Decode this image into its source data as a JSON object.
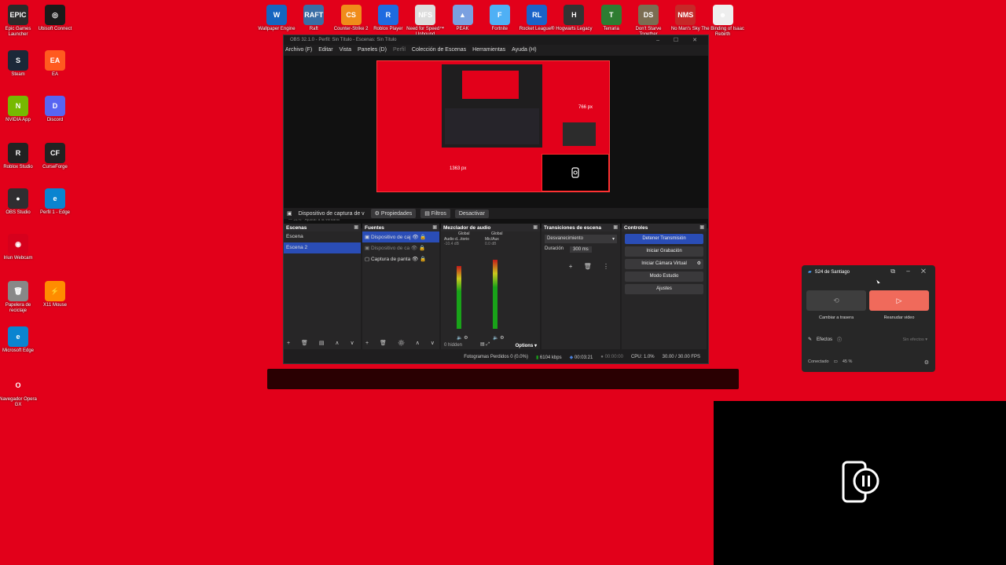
{
  "desktop": {
    "left_icons": [
      {
        "label": "Epic Games Launcher",
        "abbr": "EPIC",
        "color": "#2a2a2a"
      },
      {
        "label": "Ubisoft Connect",
        "abbr": "◎",
        "color": "#1a1a1a"
      },
      {
        "label": "Steam",
        "abbr": "S",
        "color": "#1b2838"
      },
      {
        "label": "EA",
        "abbr": "EA",
        "color": "#ff5a1f"
      },
      {
        "label": "NVIDIA App",
        "abbr": "N",
        "color": "#76b900"
      },
      {
        "label": "Discord",
        "abbr": "D",
        "color": "#5865f2"
      },
      {
        "label": "Roblox Studio",
        "abbr": "R",
        "color": "#222"
      },
      {
        "label": "CurseForge",
        "abbr": "CF",
        "color": "#222"
      },
      {
        "label": "OBS Studio",
        "abbr": "●",
        "color": "#302e31"
      },
      {
        "label": "Perfil 1 - Edge",
        "abbr": "e",
        "color": "#0a84d0"
      },
      {
        "label": "Iriun Webcam",
        "abbr": "◉",
        "color": "#d6001c"
      },
      {
        "label": "Papelera de reciclaje",
        "abbr": "🗑",
        "color": "#888"
      },
      {
        "label": "X11 Mouse",
        "abbr": "⚡",
        "color": "#ff8c00"
      },
      {
        "label": "Microsoft Edge",
        "abbr": "e",
        "color": "#0a84d0"
      },
      {
        "label": "Navegador Opera GX",
        "abbr": "O",
        "color": "#e2001a"
      }
    ],
    "top_icons": [
      {
        "label": "Wallpaper Engine",
        "abbr": "W",
        "color": "#1565c0"
      },
      {
        "label": "Raft",
        "abbr": "RAFT",
        "color": "#3a6ea5"
      },
      {
        "label": "Counter-Strike 2",
        "abbr": "CS",
        "color": "#f08c1a"
      },
      {
        "label": "Roblox Player",
        "abbr": "R",
        "color": "#1e6be0"
      },
      {
        "label": "Need for Speed™ Unbound",
        "abbr": "NFS",
        "color": "#ddd"
      },
      {
        "label": "PEAK",
        "abbr": "▲",
        "color": "#7aa0e0"
      },
      {
        "label": "Fortnite",
        "abbr": "F",
        "color": "#4fb0f5"
      },
      {
        "label": "Rocket League®",
        "abbr": "RL",
        "color": "#1a63c9"
      },
      {
        "label": "Hogwarts Legacy",
        "abbr": "H",
        "color": "#333"
      },
      {
        "label": "Terraria",
        "abbr": "T",
        "color": "#2e7d32"
      },
      {
        "label": "Don't Starve Together",
        "abbr": "DS",
        "color": "#7b6d52"
      },
      {
        "label": "No Man's Sky",
        "abbr": "NMS",
        "color": "#c62828"
      },
      {
        "label": "The Binding of Isaac Rebirth",
        "abbr": "☻",
        "color": "#eee"
      }
    ]
  },
  "obs": {
    "title": "OBS 32.1.0 - Perfil: Sin Título - Escenas: Sin Título",
    "menu": [
      "Archivo (F)",
      "Editar",
      "Vista",
      "Paneles (D)",
      "Perfil",
      "Colección de Escenas",
      "Herramientas",
      "Ayuda (H)"
    ],
    "preview": {
      "width_label": "1363 px",
      "height_label": "766 px",
      "zoom_label": "— 31% · Ajustar a la ventana"
    },
    "source_bar": {
      "source_name": "Dispositivo de captura de v",
      "properties": "Propiedades",
      "filters": "Filtros",
      "deactivate": "Desactivar"
    },
    "scenes": {
      "title": "Escenas",
      "items": [
        "Escena",
        "Escena 2"
      ],
      "selected": 1
    },
    "sources": {
      "title": "Fuentes",
      "items": [
        "Dispositivo de caj",
        "Dispositivo de ca",
        "Captura de panta"
      ]
    },
    "mixer": {
      "title": "Mezclador de audio",
      "channels": [
        {
          "name": "Audio d...itorio",
          "tag": "Global",
          "level": "-10.4 dB"
        },
        {
          "name": "Mic/Aux",
          "tag": "Global",
          "level": "0.0 dB"
        }
      ],
      "hidden": "0 hidden",
      "options": "Options"
    },
    "transitions": {
      "title": "Transiciones de escena",
      "type": "Desvanecimiento",
      "duration_label": "Duración",
      "duration_value": "300 ms"
    },
    "controls": {
      "title": "Controles",
      "buttons": [
        "Detener Transmisión",
        "Iniciar Grabación",
        "Iniciar Cámara Virtual",
        "Modo Estudio",
        "Ajustes"
      ]
    },
    "status": {
      "dropped": "Fotogramas Perdidos 0 (0.0%)",
      "bitrate": "6104 kbps",
      "stream_time": "00:03:21",
      "rec_time": "00:00:00",
      "cpu": "CPU: 1.0%",
      "fps": "30.00 / 30.00 FPS"
    }
  },
  "phone": {
    "title": "S24 de Santiago",
    "btn1_label": "Cambiar a trasera",
    "btn2_label": "Reanudar video",
    "effects_label": "Efectos",
    "effects_value": "Sin efectos",
    "status": "Conectado",
    "battery": "45 %"
  }
}
